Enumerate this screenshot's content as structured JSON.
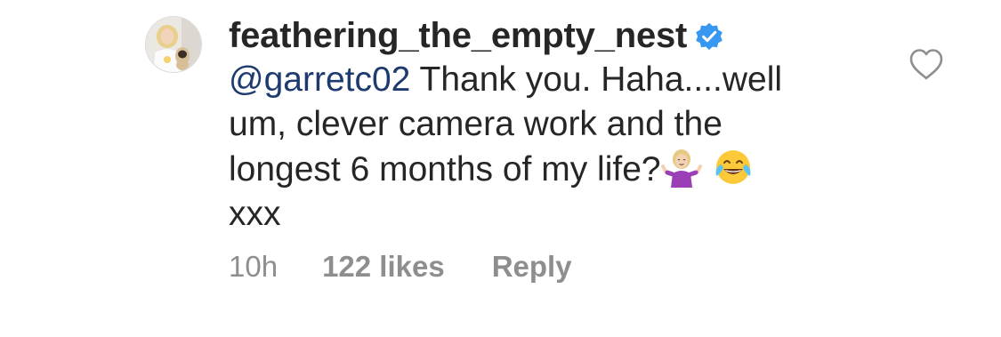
{
  "comment": {
    "username": "feathering_the_empty_nest",
    "verified": true,
    "mention": "@garretc02",
    "lines": [
      " Thank you. Haha....well",
      "um, clever camera work and the",
      "longest 6 months of my life?",
      "xxx"
    ],
    "emojis": [
      "person-shrugging-emoji",
      "face-with-tears-of-joy-emoji"
    ],
    "time": "10h",
    "likes": "122 likes",
    "reply_label": "Reply"
  },
  "colors": {
    "text": "#262626",
    "mention": "#1e3a6e",
    "muted": "#8e8e8e",
    "verified_blue": "#3897f0"
  }
}
